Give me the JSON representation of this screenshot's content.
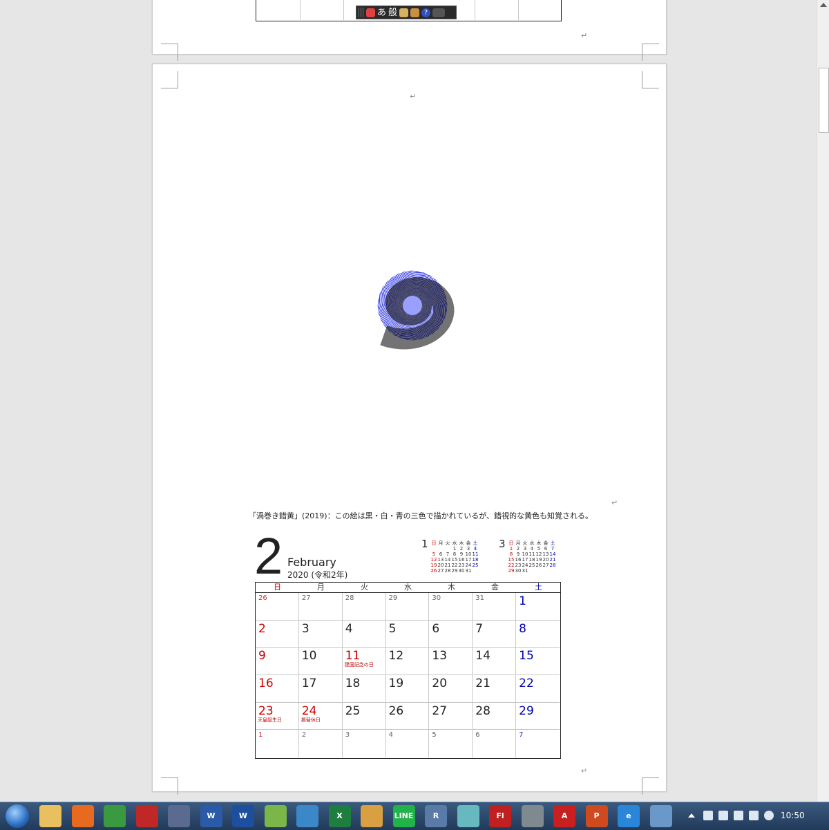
{
  "ime_toolbar": {
    "mode": "あ",
    "conversion": "般"
  },
  "caption": "「渦巻き錯黄」(2019)：この絵は黒・白・青の三色で描かれているが、錯視的な黄色も知覚される。",
  "paragraph_mark": "↵",
  "calendar": {
    "month_number": "2",
    "month_name": "February",
    "year_line": "2020 (令和2年)",
    "weekdays": [
      "日",
      "月",
      "火",
      "水",
      "木",
      "金",
      "土"
    ],
    "weeks": [
      [
        {
          "d": "26",
          "prev": true
        },
        {
          "d": "27",
          "prev": true
        },
        {
          "d": "28",
          "prev": true
        },
        {
          "d": "29",
          "prev": true
        },
        {
          "d": "30",
          "prev": true
        },
        {
          "d": "31",
          "prev": true
        },
        {
          "d": "1"
        }
      ],
      [
        {
          "d": "2"
        },
        {
          "d": "3"
        },
        {
          "d": "4"
        },
        {
          "d": "5"
        },
        {
          "d": "6"
        },
        {
          "d": "7"
        },
        {
          "d": "8"
        }
      ],
      [
        {
          "d": "9"
        },
        {
          "d": "10"
        },
        {
          "d": "11",
          "holiday": "建国記念の日"
        },
        {
          "d": "12"
        },
        {
          "d": "13"
        },
        {
          "d": "14"
        },
        {
          "d": "15"
        }
      ],
      [
        {
          "d": "16"
        },
        {
          "d": "17"
        },
        {
          "d": "18"
        },
        {
          "d": "19"
        },
        {
          "d": "20"
        },
        {
          "d": "21"
        },
        {
          "d": "22"
        }
      ],
      [
        {
          "d": "23",
          "holiday": "天皇誕生日"
        },
        {
          "d": "24",
          "holiday": "振替休日"
        },
        {
          "d": "25"
        },
        {
          "d": "26"
        },
        {
          "d": "27"
        },
        {
          "d": "28"
        },
        {
          "d": "29"
        }
      ],
      [
        {
          "d": "1",
          "next": true
        },
        {
          "d": "2",
          "next": true
        },
        {
          "d": "3",
          "next": true
        },
        {
          "d": "4",
          "next": true
        },
        {
          "d": "5",
          "next": true
        },
        {
          "d": "6",
          "next": true
        },
        {
          "d": "7",
          "next": true
        }
      ]
    ],
    "mini_prev": {
      "number": "1",
      "header": [
        "日",
        "月",
        "火",
        "水",
        "木",
        "金",
        "土"
      ],
      "rows": [
        [
          "",
          "",
          "",
          "1",
          "2",
          "3",
          "4"
        ],
        [
          "5",
          "6",
          "7",
          "8",
          "9",
          "10",
          "11"
        ],
        [
          "12",
          "13",
          "14",
          "15",
          "16",
          "17",
          "18"
        ],
        [
          "19",
          "20",
          "21",
          "22",
          "23",
          "24",
          "25"
        ],
        [
          "26",
          "27",
          "28",
          "29",
          "30",
          "31",
          ""
        ]
      ]
    },
    "mini_next": {
      "number": "3",
      "header": [
        "日",
        "月",
        "火",
        "水",
        "木",
        "金",
        "土"
      ],
      "rows": [
        [
          "1",
          "2",
          "3",
          "4",
          "5",
          "6",
          "7"
        ],
        [
          "8",
          "9",
          "10",
          "11",
          "12",
          "13",
          "14"
        ],
        [
          "15",
          "16",
          "17",
          "18",
          "19",
          "20",
          "21"
        ],
        [
          "22",
          "23",
          "24",
          "25",
          "26",
          "27",
          "28"
        ],
        [
          "29",
          "30",
          "31",
          "",
          "",
          "",
          ""
        ]
      ]
    }
  },
  "colors": {
    "sunday": "#d00000",
    "saturday": "#0000b0",
    "spiral_blue": "#0a14e6",
    "spiral_black": "#000000"
  },
  "taskbar": {
    "apps": [
      "windows-explorer",
      "firefox",
      "chrome",
      "screenshot-tool",
      "disk-tool",
      "word-doc",
      "word",
      "evernote",
      "cloud",
      "excel",
      "search-tool",
      "line",
      "r",
      "notes",
      "flash",
      "lock-tool",
      "pdf",
      "powerpoint",
      "internet-explorer",
      "photo-viewer"
    ],
    "clock": "10:50"
  }
}
